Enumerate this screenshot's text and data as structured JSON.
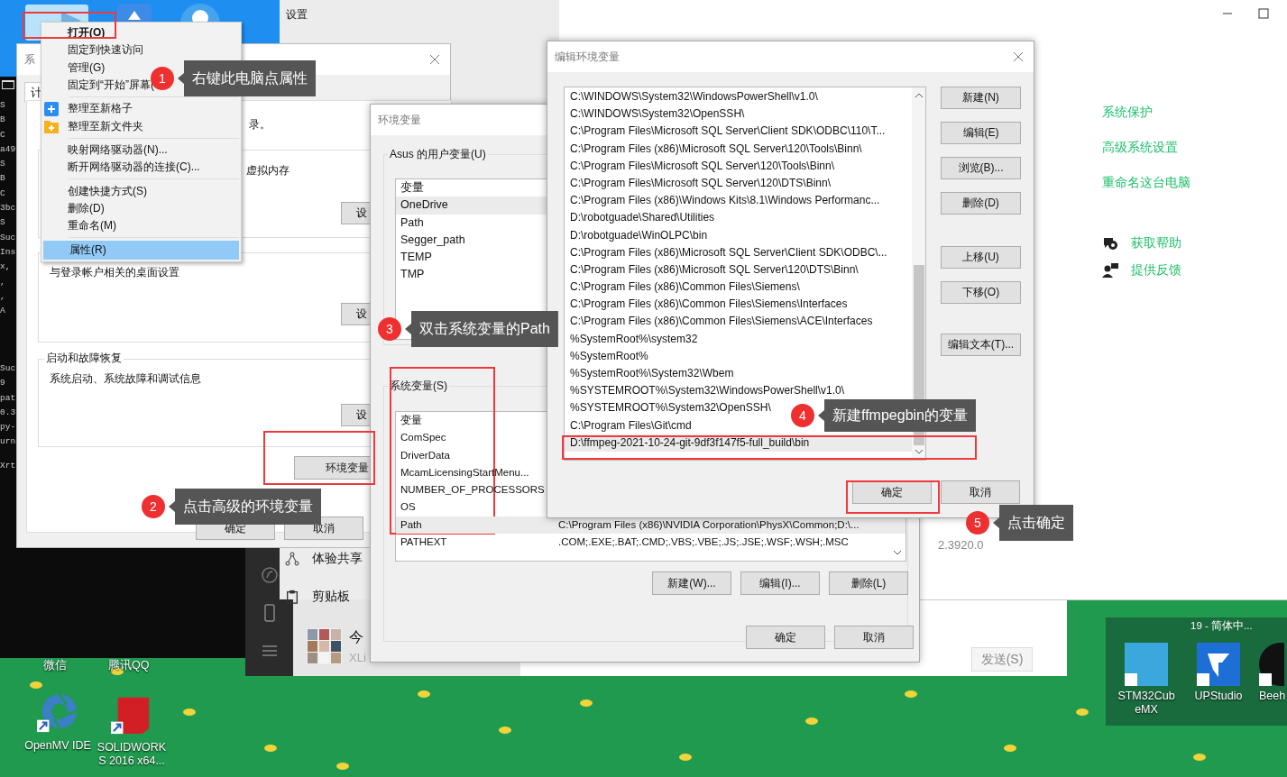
{
  "terminal": {
    "blocks": [
      [
        "S",
        "B",
        "C",
        "a49",
        "S",
        "B",
        "C",
        "3bc",
        "S",
        "Suc",
        "Ins",
        "x,",
        ",",
        ",",
        "A"
      ],
      [
        "Suc",
        "9",
        "pat",
        "0.3",
        "py-",
        "urn"
      ],
      [
        "Xrt"
      ]
    ]
  },
  "settings_window": {
    "title": "设置",
    "items": [
      "体验共享",
      "剪贴板"
    ]
  },
  "wechat": {
    "chat_name": "今",
    "chat_preview": "XLi",
    "send_button": "发送(S)"
  },
  "about_window": {
    "links": [
      "系统保护",
      "高级系统设置",
      "重命名这台电脑"
    ],
    "help_links": [
      "获取帮助",
      "提供反馈"
    ],
    "version": "2.3920.0"
  },
  "system_properties": {
    "title": "系",
    "tab": "计",
    "intro": "录。",
    "performance_text": "虚拟内存",
    "profiles_text": "与登录帐户相关的桌面设置",
    "startup_group": "启动和故障恢复",
    "startup_text": "系统启动、系统故障和调试信息",
    "settings_buttons": [
      "设",
      "设",
      "设"
    ],
    "env_button": "环境变量",
    "ok": "确定",
    "cancel": "取消"
  },
  "context_menu": {
    "groups": [
      [
        {
          "label": "打开(O)",
          "kind": "default",
          "selected": false
        },
        {
          "label": "固定到快速访问",
          "kind": "plain",
          "selected": false
        },
        {
          "label": "管理(G)",
          "kind": "plain",
          "selected": false
        },
        {
          "label": "固定到“开始”屏幕(",
          "kind": "plain",
          "selected": false
        }
      ],
      [
        {
          "label": "整理至新格子",
          "kind": "grid",
          "selected": false
        },
        {
          "label": "整理至新文件夹",
          "kind": "folder",
          "selected": false
        }
      ],
      [
        {
          "label": "映射网络驱动器(N)...",
          "kind": "plain",
          "selected": false
        },
        {
          "label": "断开网络驱动器的连接(C)...",
          "kind": "plain",
          "selected": false
        }
      ],
      [
        {
          "label": "创建快捷方式(S)",
          "kind": "plain",
          "selected": false
        },
        {
          "label": "删除(D)",
          "kind": "plain",
          "selected": false
        },
        {
          "label": "重命名(M)",
          "kind": "plain",
          "selected": false
        }
      ],
      [
        {
          "label": "属性(R)",
          "kind": "plain",
          "selected": true
        }
      ]
    ]
  },
  "env_window": {
    "title": "环境变量",
    "user_group": "Asus 的用户变量(U)",
    "user_header": "变量",
    "user_vars": [
      {
        "name": "OneDrive",
        "selected": true
      },
      {
        "name": "Path",
        "selected": false
      },
      {
        "name": "Segger_path",
        "selected": false
      },
      {
        "name": "TEMP",
        "selected": false
      },
      {
        "name": "TMP",
        "selected": false
      }
    ],
    "system_group": "系统变量(S)",
    "system_header": "变量",
    "system_vars": [
      {
        "name": "ComSpec",
        "selected": false
      },
      {
        "name": "DriverData",
        "selected": false
      },
      {
        "name": "McamLicensingStartMenu...",
        "selected": false
      },
      {
        "name": "NUMBER_OF_PROCESSORS",
        "selected": false
      },
      {
        "name": "OS",
        "selected": false
      },
      {
        "name": "Path",
        "value": "C:\\Program Files (x86)\\NVIDIA Corporation\\PhysX\\Common;D:\\...",
        "selected": true
      },
      {
        "name": "PATHEXT",
        "value": ".COM;.EXE;.BAT;.CMD;.VBS;.VBE;.JS;.JSE;.WSF;.WSH;.MSC",
        "selected": false
      }
    ],
    "buttons": [
      "新建(W)...",
      "编辑(I)...",
      "删除(L)"
    ],
    "ok": "确定",
    "cancel": "取消"
  },
  "edit_window": {
    "title": "编辑环境变量",
    "paths": [
      {
        "text": "C:\\WINDOWS\\System32\\WindowsPowerShell\\v1.0\\",
        "selected": false
      },
      {
        "text": "C:\\WINDOWS\\System32\\OpenSSH\\",
        "selected": false
      },
      {
        "text": "C:\\Program Files\\Microsoft SQL Server\\Client SDK\\ODBC\\110\\T...",
        "selected": false
      },
      {
        "text": "C:\\Program Files (x86)\\Microsoft SQL Server\\120\\Tools\\Binn\\",
        "selected": false
      },
      {
        "text": "C:\\Program Files\\Microsoft SQL Server\\120\\Tools\\Binn\\",
        "selected": false
      },
      {
        "text": "C:\\Program Files\\Microsoft SQL Server\\120\\DTS\\Binn\\",
        "selected": false
      },
      {
        "text": "C:\\Program Files (x86)\\Windows Kits\\8.1\\Windows Performanc...",
        "selected": false
      },
      {
        "text": "D:\\robotguade\\Shared\\Utilities",
        "selected": false
      },
      {
        "text": "D:\\robotguade\\WinOLPC\\bin",
        "selected": false
      },
      {
        "text": "C:\\Program Files (x86)\\Microsoft SQL Server\\Client SDK\\ODBC\\...",
        "selected": false
      },
      {
        "text": "C:\\Program Files (x86)\\Microsoft SQL Server\\120\\DTS\\Binn\\",
        "selected": false
      },
      {
        "text": "C:\\Program Files (x86)\\Common Files\\Siemens\\",
        "selected": false
      },
      {
        "text": "C:\\Program Files (x86)\\Common Files\\Siemens\\Interfaces",
        "selected": false
      },
      {
        "text": "C:\\Program Files (x86)\\Common Files\\Siemens\\ACE\\Interfaces",
        "selected": false
      },
      {
        "text": "%SystemRoot%\\system32",
        "selected": false
      },
      {
        "text": "%SystemRoot%",
        "selected": false
      },
      {
        "text": "%SystemRoot%\\System32\\Wbem",
        "selected": false
      },
      {
        "text": "%SYSTEMROOT%\\System32\\WindowsPowerShell\\v1.0\\",
        "selected": false
      },
      {
        "text": "%SYSTEMROOT%\\System32\\OpenSSH\\",
        "selected": false
      },
      {
        "text": "C:\\Program Files\\Git\\cmd",
        "selected": false
      },
      {
        "text": "D:\\ffmpeg-2021-10-24-git-9df3f147f5-full_build\\bin",
        "selected": true
      }
    ],
    "buttons": [
      "新建(N)",
      "编辑(E)",
      "浏览(B)...",
      "删除(D)",
      "上移(U)",
      "下移(O)",
      "编辑文本(T)..."
    ],
    "ok": "确定",
    "cancel": "取消"
  },
  "desktop_icons": [
    "微信",
    "腾讯QQ",
    "OpenMV IDE",
    "SOLIDWORKS 2016 x64...",
    "STM32CubeMX",
    "UPStudio",
    "Beeh"
  ],
  "tray_text": "19 - 简体中...",
  "steps": [
    {
      "number": "1",
      "text": "右键此电脑点属性"
    },
    {
      "number": "2",
      "text": "点击高级的环境变量"
    },
    {
      "number": "3",
      "text": "双击系统变量的Path"
    },
    {
      "number": "4",
      "text": "新建ffmpegbin的变量"
    },
    {
      "number": "5",
      "text": "点击确定"
    }
  ]
}
